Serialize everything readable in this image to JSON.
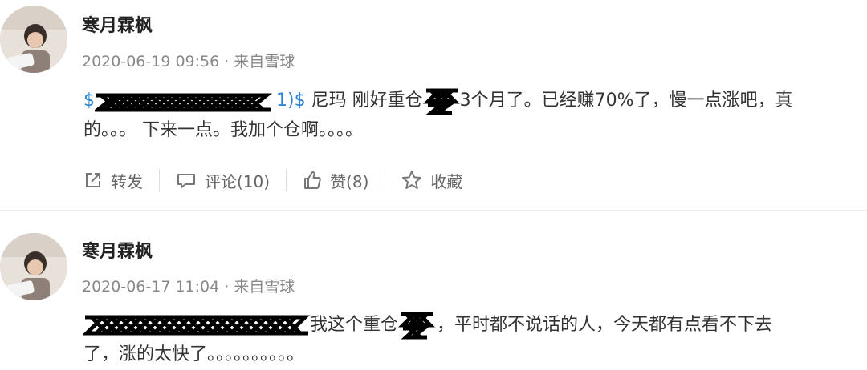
{
  "posts": [
    {
      "author": "寒月霖枫",
      "date": "2020-06-19 09:56",
      "source": "来自雪球",
      "content": {
        "line1_link_start": "$",
        "line1_link_end": "1)$",
        "line1_text_a": " 尼玛 刚好重仓",
        "line1_text_b": "3个月了。已经赚70%了，慢一点涨吧，真",
        "line2_text": "的。。。 下来一点。我加个仓啊。。。。"
      },
      "actions": {
        "repost": "转发",
        "comment": "评论(10)",
        "like": "赞(8)",
        "favorite": "收藏"
      }
    },
    {
      "author": "寒月霖枫",
      "date": "2020-06-17 11:04",
      "source": "来自雪球",
      "content": {
        "line1_text_a": "我这个重仓",
        "line1_text_b": "，平时都不说话的人，今天都有点看不下去",
        "line2_text": "了，涨的太快了。。。。。。。。。。"
      }
    }
  ],
  "colors": {
    "link": "#2f84d4",
    "meta": "#888888",
    "action": "#666666"
  }
}
